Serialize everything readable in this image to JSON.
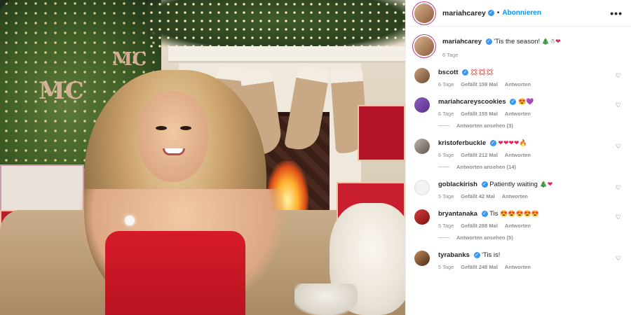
{
  "post": {
    "username": "mariahcarey",
    "follow_label": "Abonnieren",
    "more_label": "•••",
    "caption_text": "'Tis the season!",
    "caption_emojis": [
      "🎄",
      "☃",
      "❤"
    ],
    "caption_time": "6 Tage"
  },
  "comments": [
    {
      "username": "bscott",
      "text": "",
      "emojis": [
        "💢",
        "💢",
        "💢"
      ],
      "time": "6 Tage",
      "likes": "Gefällt 159 Mal",
      "reply": "Antworten",
      "view_replies": ""
    },
    {
      "username": "mariahcareyscookies",
      "text": "",
      "emojis": [
        "😍",
        "💜"
      ],
      "time": "6 Tage",
      "likes": "Gefällt 155 Mal",
      "reply": "Antworten",
      "view_replies": "Antworten ansehen (3)"
    },
    {
      "username": "kristoferbuckle",
      "text": "",
      "emojis": [
        "❤",
        "❤",
        "❤",
        "❤",
        "🔥"
      ],
      "time": "6 Tage",
      "likes": "Gefällt 212 Mal",
      "reply": "Antworten",
      "view_replies": "Antworten ansehen (14)"
    },
    {
      "username": "goblackirish",
      "text": "Patiently waiting",
      "emojis": [
        "🎄",
        "❤"
      ],
      "time": "5 Tage",
      "likes": "Gefällt 42 Mal",
      "reply": "Antworten",
      "view_replies": ""
    },
    {
      "username": "bryantanaka",
      "text": "Tis",
      "emojis": [
        "😍",
        "😍",
        "😍",
        "😍",
        "😍"
      ],
      "time": "5 Tage",
      "likes": "Gefällt 288 Mal",
      "reply": "Antworten",
      "view_replies": "Antworten ansehen (5)"
    },
    {
      "username": "tyrabanks",
      "text": "'Tis is!",
      "emojis": [],
      "time": "5 Tage",
      "likes": "Gefällt 248 Mal",
      "reply": "Antworten",
      "view_replies": ""
    }
  ],
  "icons": {
    "verified": "verified-badge-icon",
    "heart": "heart-outline-icon",
    "more": "more-options-icon"
  },
  "colors": {
    "accent": "#0095f6",
    "verified": "#3897f0",
    "meta": "#8e8e8e"
  }
}
